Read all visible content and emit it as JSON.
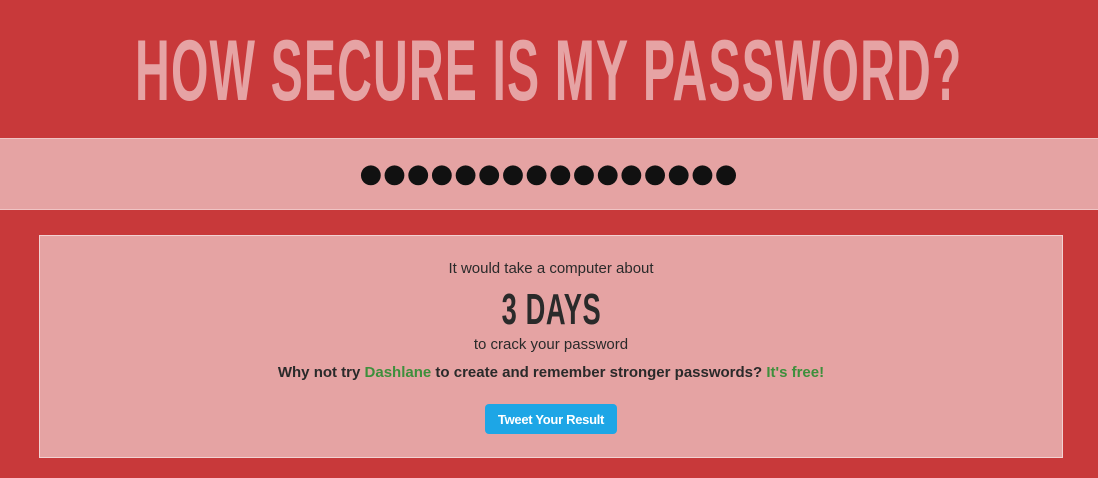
{
  "header": {
    "title": "HOW SECURE IS MY PASSWORD?"
  },
  "password": {
    "value": "●●●●●●●●●●●●●●●●"
  },
  "result": {
    "lead": "It would take a computer about",
    "time": "3 DAYS",
    "follow": "to crack your password",
    "promo_prefix": "Why not try",
    "promo_link": "Dashlane",
    "promo_middle": "to create and remember stronger passwords?",
    "promo_free": "It's free!",
    "tweet_label": "Tweet Your Result"
  },
  "colors": {
    "page_background": "#c8393a",
    "panel_background": "#e5a3a3",
    "title_color": "#e6a3a4",
    "link_green": "#3e8f3c",
    "tweet_blue": "#1da6e6"
  }
}
